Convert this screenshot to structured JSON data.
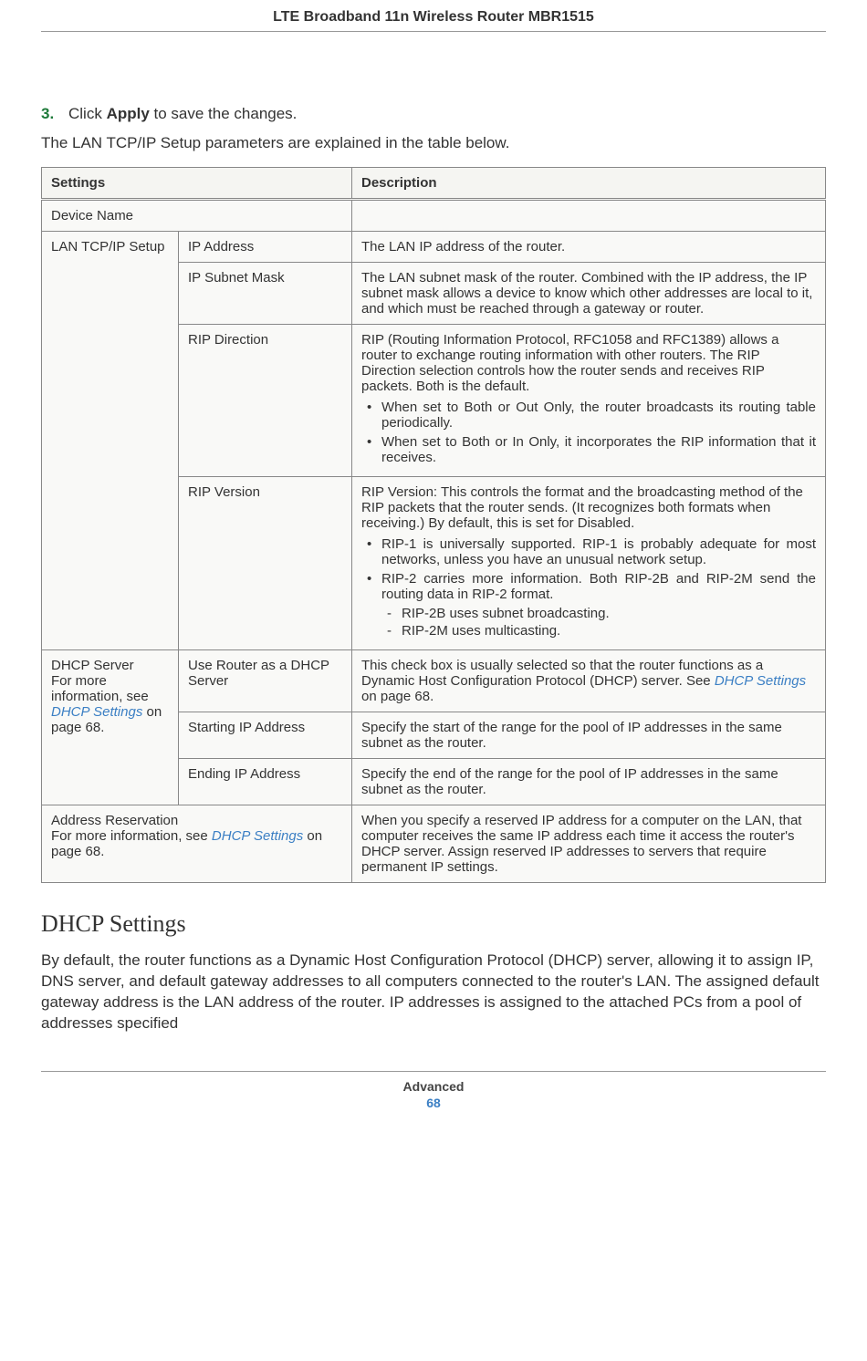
{
  "header": {
    "title": "LTE Broadband 11n Wireless Router MBR1515"
  },
  "step": {
    "num": "3.",
    "prefix": "Click ",
    "bold": "Apply",
    "suffix": " to save the changes."
  },
  "intro": "The LAN TCP/IP Setup parameters are explained in the table below.",
  "table": {
    "head": {
      "settings": "Settings",
      "description": "Description"
    },
    "device_name": "Device Name",
    "lan_group": "LAN TCP/IP Setup",
    "lan": {
      "ip_address": {
        "label": "IP Address",
        "desc": "The LAN IP address of the router."
      },
      "subnet": {
        "label": "IP Subnet Mask",
        "desc": "The LAN subnet mask of the router. Combined with the IP address, the IP subnet mask allows a device to know which other addresses are local to it, and which must be reached through a gateway or router."
      },
      "rip_dir": {
        "label": "RIP Direction",
        "desc": "RIP (Routing Information Protocol, RFC1058 and RFC1389) allows a router to exchange routing information with other routers. The RIP Direction selection controls how the router sends and receives RIP packets. Both is the default.",
        "b1": "When set to Both or Out Only, the router broadcasts its routing table periodically.",
        "b2": "When set to Both or In Only, it incorporates the RIP information that it receives."
      },
      "rip_ver": {
        "label": "RIP Version",
        "desc": "RIP Version: This controls the format and the broadcasting method of the RIP packets that the router sends. (It recognizes both formats when receiving.) By default, this is set for Disabled.",
        "b1": "RIP-1 is universally supported. RIP-1 is probably adequate for most networks, unless you have an unusual network setup.",
        "b2": "RIP-2 carries more information. Both RIP-2B and RIP-2M send the routing data in RIP-2 format.",
        "s1": "RIP-2B uses subnet broadcasting.",
        "s2": "RIP-2M uses multicasting."
      }
    },
    "dhcp_group": {
      "title": "DHCP Server",
      "more_prefix": "For more information, see ",
      "more_link": "DHCP Settings",
      "more_suffix": " on page 68."
    },
    "dhcp": {
      "use": {
        "label": "Use Router as a DHCP Server",
        "desc_prefix": "This check box is usually selected so that the router functions as a Dynamic Host Configuration Protocol (DHCP) server. See ",
        "desc_link": "DHCP Settings",
        "desc_suffix": " on page 68."
      },
      "start": {
        "label": "Starting IP Address",
        "desc": "Specify the start of the range for the pool of IP addresses in the same subnet as the router."
      },
      "end": {
        "label": "Ending IP Address",
        "desc": "Specify the end of the range for the pool of IP addresses in the same subnet as the router."
      }
    },
    "addr_res": {
      "title": "Address Reservation",
      "more_prefix": "For more information, see ",
      "more_link": "DHCP Settings",
      "more_suffix": " on page 68.",
      "desc": "When you specify a reserved IP address for a computer on the LAN, that computer receives the same IP address each time it access the router's DHCP server. Assign reserved IP addresses to servers that require permanent IP settings."
    }
  },
  "section": {
    "heading": "DHCP Settings",
    "para": "By default, the router functions as a Dynamic Host Configuration Protocol (DHCP) server, allowing it to assign IP, DNS server, and default gateway addresses to all computers connected to the router's LAN. The assigned default gateway address is the LAN address of the router. IP addresses is assigned to the attached PCs from a pool of addresses specified"
  },
  "footer": {
    "label": "Advanced",
    "page": "68"
  }
}
